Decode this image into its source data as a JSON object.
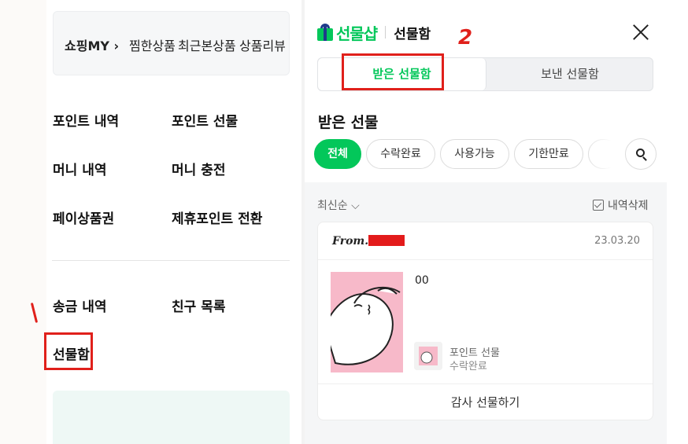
{
  "shopping": {
    "my_label": "쇼핑MY ›",
    "links": [
      "찜한상품",
      "최근본상품",
      "상품리뷰"
    ]
  },
  "menu": {
    "row1": [
      "포인트 내역",
      "포인트 선물"
    ],
    "row2": [
      "머니 내역",
      "머니 충전"
    ],
    "row3": [
      "페이상품권",
      "제휴포인트 전환"
    ],
    "row4": [
      "송금 내역",
      "친구 목록"
    ],
    "gift_box": "선물함"
  },
  "annotations": {
    "mark2": "2"
  },
  "header": {
    "brand": "선물샵",
    "subtitle": "선물함"
  },
  "tabs": [
    "받은 선물함",
    "보낸 선물함"
  ],
  "section_title": "받은 선물",
  "filters": [
    "전체",
    "수락완료",
    "사용가능",
    "기한만료"
  ],
  "list": {
    "sort": "최신순",
    "delete": "내역삭제"
  },
  "card": {
    "from": "From.",
    "date": "23.03.20",
    "message": "00",
    "item_name": "포인트 선물",
    "item_status": "수락완료",
    "thanks_button": "감사 선물하기"
  },
  "colors": {
    "accent": "#03c75a",
    "annotation": "#e0201b",
    "thumb_bg": "#f7b9c9"
  },
  "icons": [
    "gift-box-icon",
    "close-icon",
    "search-icon",
    "chevron-down-icon",
    "checkbox-icon"
  ]
}
